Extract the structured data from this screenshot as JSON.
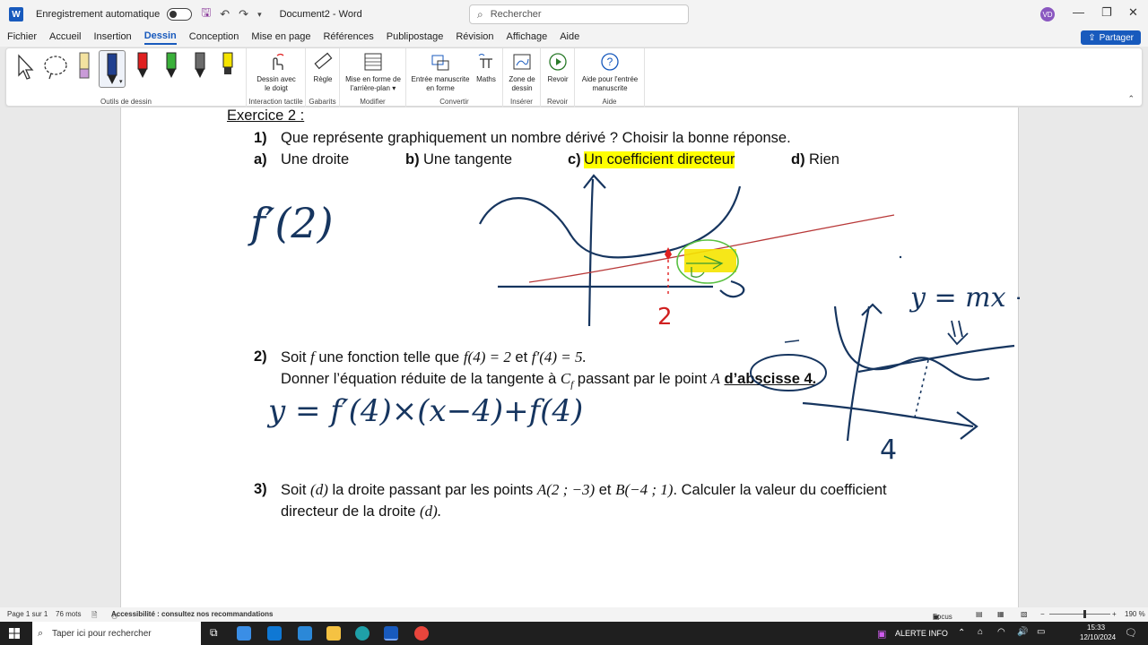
{
  "titlebar": {
    "app_icon": "W",
    "autosave_label": "Enregistrement automatique",
    "doc_title": "Document2 - Word",
    "search_placeholder": "Rechercher",
    "user_initials": "VD",
    "minimize": "—",
    "restore": "❐",
    "close": "✕"
  },
  "menu": {
    "tabs": [
      "Fichier",
      "Accueil",
      "Insertion",
      "Dessin",
      "Conception",
      "Mise en page",
      "Références",
      "Publipostage",
      "Révision",
      "Affichage",
      "Aide"
    ],
    "share_label": "Partager"
  },
  "ribbon": {
    "groups": {
      "drawing_tools": "Outils de dessin",
      "touch": "Interaction tactile",
      "stencils": "Gabarits",
      "modify": "Modifier",
      "convert": "Convertir",
      "insert": "Insérer",
      "replay": "Revoir",
      "help": "Aide"
    },
    "buttons": {
      "finger_draw_1": "Dessin avec",
      "finger_draw_2": "le doigt",
      "ruler": "Règle",
      "bg_format_1": "Mise en forme de",
      "bg_format_2": "l'arrière-plan",
      "ink_to_shape_1": "Entrée manuscrite",
      "ink_to_shape_2": "en forme",
      "math": "Maths",
      "canvas_1": "Zone de",
      "canvas_2": "dessin",
      "replay": "Revoir",
      "help_1": "Aide pour l'entrée",
      "help_2": "manuscrite"
    },
    "pen_colors": [
      "#1f3f8f",
      "#e02020",
      "#3ab03a",
      "#6b6b6b",
      "#f5e400"
    ]
  },
  "document": {
    "exercise_title": "Exercice 2 :",
    "q1_num": "1)",
    "q1_text": "Que représente graphiquement un nombre dérivé ?  Choisir la bonne réponse.",
    "a_label": "a)",
    "a_text": "Une droite",
    "b_label": "b)",
    "b_text": "Une tangente",
    "c_label": "c)",
    "c_text": "Un coefficient directeur",
    "d_label": "d)",
    "d_text": "Rien",
    "q2_num": "2)",
    "q2_line1_a": "Soit ",
    "q2_f": "f",
    "q2_line1_b": " une fonction telle que ",
    "q2_f4": "f(4) = 2",
    "q2_et": " et ",
    "q2_fp4": "f′(4) = 5.",
    "q2_line2_a": "Donner l’équation réduite de la tangente à ",
    "q2_cf": "C",
    "q2_cf_sub": "f",
    "q2_line2_b": " passant par le point ",
    "q2_A": "A",
    "q2_abscisse": "d’abscisse 4.",
    "q3_num": "3)",
    "q3_line1_a": "Soit ",
    "q3_d": "(d)",
    "q3_line1_b": " la droite passant par les points ",
    "q3_A": "A(2 ; −3)",
    "q3_et": " et ",
    "q3_B": "B(−4 ; 1)",
    "q3_line1_c": ". Calculer la valeur du coefficient",
    "q3_line2_a": "directeur de la droite ",
    "q3_d2": "(d).",
    "ink_f2": "f′(2)",
    "ink_2": "2",
    "ink_eq": "y = f′(4)×(x−4)+f(4)",
    "ink_ymx": "y = mx + p",
    "ink_4": "4"
  },
  "statusbar": {
    "page": "Page 1 sur 1",
    "words": "76 mots",
    "accessibility": "Accessibilité : consultez nos recommandations",
    "focus": "Focus",
    "zoom": "190 %"
  },
  "taskbar": {
    "search_placeholder": "Taper ici pour rechercher",
    "alert": "ALERTE INFO",
    "time": "15:33",
    "date": "12/10/2024"
  }
}
